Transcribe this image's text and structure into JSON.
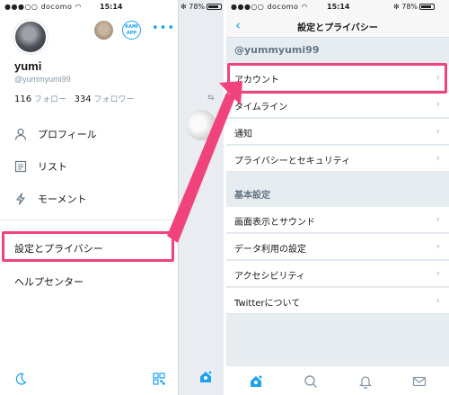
{
  "status": {
    "carrier": "docomo",
    "time": "15:14",
    "battery": "78%"
  },
  "drawer": {
    "name": "yumi",
    "handle": "@yummyumi99",
    "following_count": "116",
    "following_label": "フォロー",
    "followers_count": "334",
    "followers_label": "フォロワー",
    "kami_label_1": "KAMI",
    "kami_label_2": "APP",
    "menu": [
      {
        "label": "プロフィール",
        "icon": "person-icon"
      },
      {
        "label": "リスト",
        "icon": "list-icon"
      },
      {
        "label": "モーメント",
        "icon": "lightning-icon"
      }
    ],
    "settings_label": "設定とプライバシー",
    "help_label": "ヘルプセンター"
  },
  "settings": {
    "title": "設定とプライバシー",
    "account_handle": "@yummyumi99",
    "account_rows": [
      {
        "label": "アカウント"
      },
      {
        "label": "タイムライン"
      },
      {
        "label": "通知"
      },
      {
        "label": "プライバシーとセキュリティ"
      }
    ],
    "general_header": "基本設定",
    "general_rows": [
      {
        "label": "画面表示とサウンド"
      },
      {
        "label": "データ利用の設定"
      },
      {
        "label": "アクセシビリティ"
      },
      {
        "label": "Twitterについて"
      }
    ],
    "chevron": "›",
    "back": "‹"
  },
  "colors": {
    "accent": "#1da1f2",
    "highlight": "#f0437c",
    "group_bg": "#e6ecf0"
  }
}
